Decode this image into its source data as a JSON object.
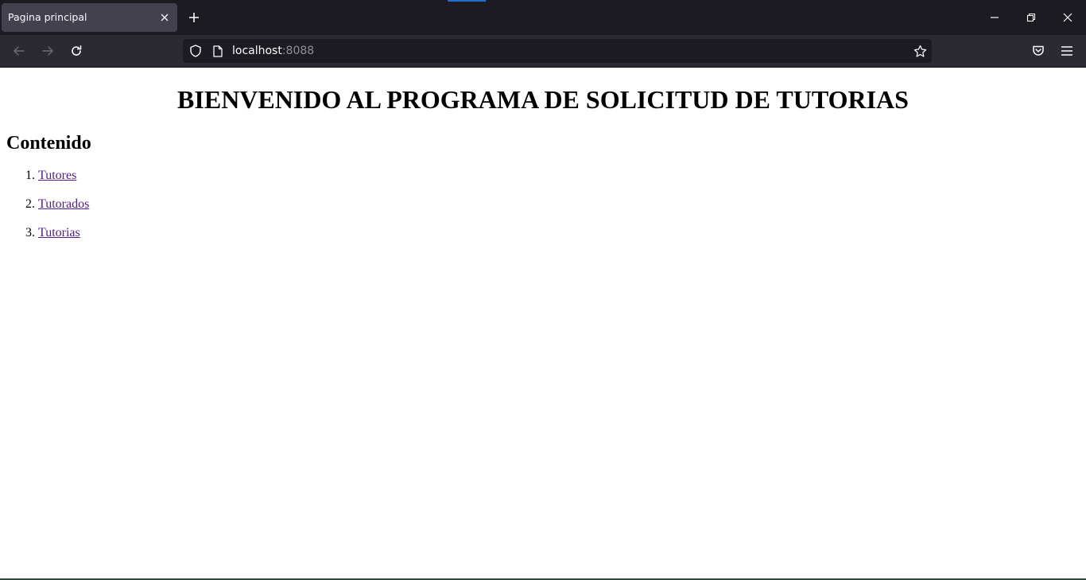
{
  "browser": {
    "tab": {
      "title": "Pagina principal"
    },
    "url": {
      "host": "localhost",
      "port": ":8088"
    }
  },
  "page": {
    "title": "BIENVENIDO AL PROGRAMA DE SOLICITUD DE TUTORIAS",
    "section_title": "Contenido",
    "links": [
      {
        "label": "Tutores"
      },
      {
        "label": "Tutorados"
      },
      {
        "label": "Tutorias"
      }
    ],
    "link_color": "#551a8b"
  },
  "icons": {
    "tab_close": "close-icon",
    "new_tab": "plus-icon",
    "back": "arrow-left-icon",
    "forward": "arrow-right-icon",
    "reload": "reload-icon",
    "shield": "shield-icon",
    "page": "page-icon",
    "bookmark": "star-icon",
    "pocket": "pocket-icon",
    "menu": "hamburger-menu-icon",
    "minimize": "minimize-icon",
    "restore": "restore-icon",
    "close_window": "close-window-icon"
  },
  "colors": {
    "tabstrip_bg": "#1c1b22",
    "toolbar_bg": "#2b2a33",
    "active_tab_bg": "#42414d",
    "urlbar_bg": "#1c1b22",
    "accent": "#1f6fd1"
  }
}
